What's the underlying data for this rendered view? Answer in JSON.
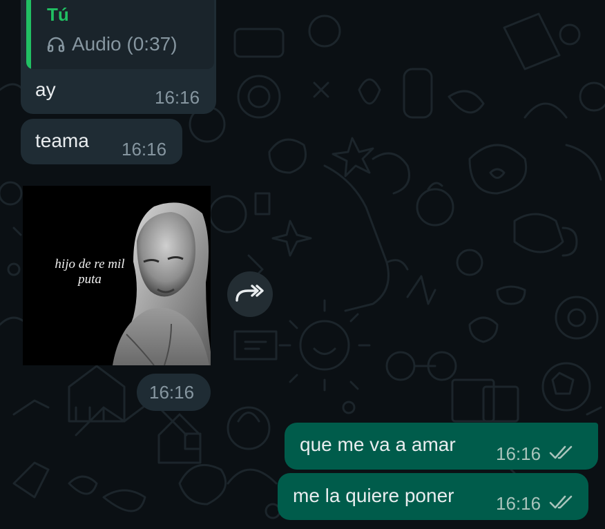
{
  "colors": {
    "background": "#0b1014",
    "incoming_bubble": "#1f2c34",
    "outgoing_bubble": "#005c4b",
    "quote_accent": "#21c063",
    "timestamp": "#8696a0"
  },
  "messages": [
    {
      "direction": "incoming",
      "quoted": {
        "author": "Tú",
        "icon": "headphones-icon",
        "text": "Audio (0:37)"
      },
      "text": "ay",
      "time": "16:16"
    },
    {
      "direction": "incoming",
      "text": "teama",
      "time": "16:16"
    },
    {
      "direction": "incoming",
      "type": "image",
      "image_caption": [
        "hijo de re mil",
        "puta"
      ],
      "time": "16:16",
      "forward_icon": "forward-icon"
    },
    {
      "direction": "outgoing",
      "text": "que me va a amar",
      "time": "16:16",
      "status_icon": "double-check-icon"
    },
    {
      "direction": "outgoing",
      "text": "me la quiere poner",
      "time": "16:16",
      "status_icon": "double-check-icon"
    }
  ]
}
